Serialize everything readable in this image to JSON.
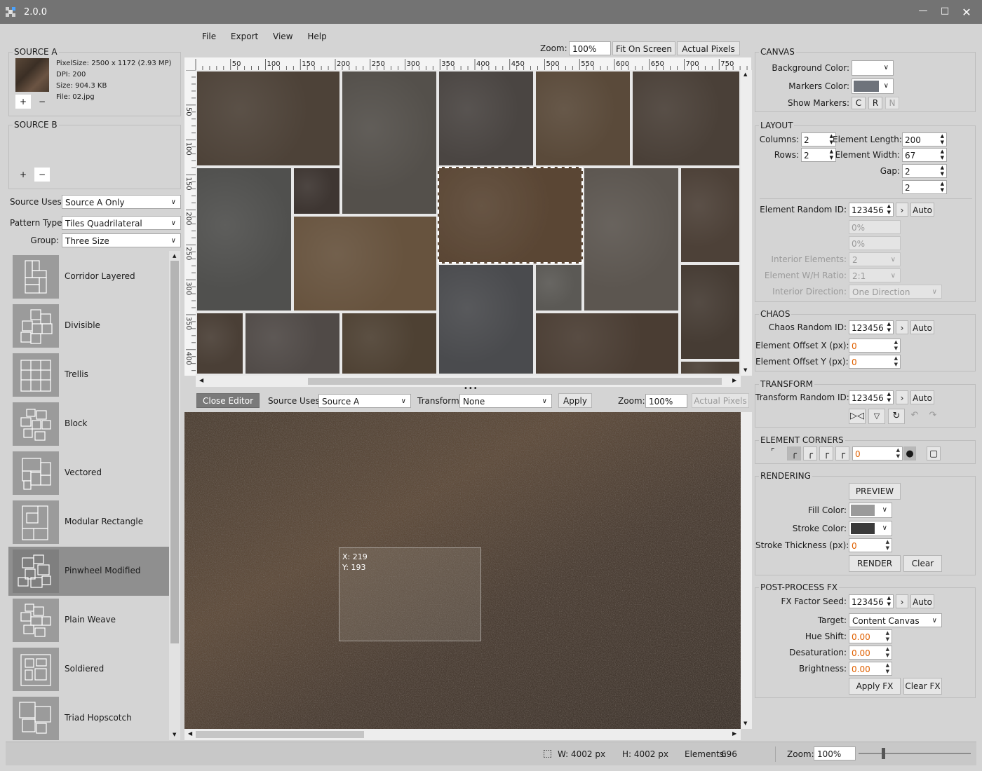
{
  "window": {
    "title": "2.0.0",
    "controls": [
      "minimize-icon",
      "maximize-icon",
      "close-icon"
    ]
  },
  "menu": [
    "File",
    "Export",
    "View",
    "Help"
  ],
  "zoom_bar": {
    "label": "Zoom:",
    "value": "100%",
    "fit": "Fit On Screen",
    "actual": "Actual Pixels"
  },
  "source_a": {
    "title": "SOURCE A",
    "info": [
      "PixelSize: 2500 x 1172 (2.93 MP)",
      "DPI: 200",
      "Size: 904.3 KB",
      "File: 02.jpg"
    ],
    "add": "+",
    "remove": "−"
  },
  "source_b": {
    "title": "SOURCE B",
    "add": "+",
    "remove": "−"
  },
  "left_form": {
    "source_uses_label": "Source Uses:",
    "source_uses": "Source A Only",
    "pattern_type_label": "Pattern Type:",
    "pattern_type": "Tiles Quadrilateral",
    "group_label": "Group:",
    "group": "Three Size"
  },
  "patterns": [
    "Corridor Layered",
    "Divisible",
    "Trellis",
    "Block",
    "Vectored",
    "Modular Rectangle",
    "Pinwheel Modified",
    "Plain Weave",
    "Soldiered",
    "Triad Hopscotch"
  ],
  "selected_pattern": "Pinwheel Modified",
  "ruler": {
    "h": [
      "50",
      "100",
      "150",
      "200",
      "250",
      "300",
      "350",
      "400",
      "450",
      "500",
      "550",
      "600",
      "650",
      "700",
      "750"
    ],
    "v": [
      "50",
      "100",
      "150",
      "200",
      "250",
      "300",
      "350",
      "400"
    ]
  },
  "editor": {
    "close": "Close Editor",
    "source_uses_label": "Source Uses:",
    "source_uses": "Source A",
    "transform_label": "Transform:",
    "transform": "None",
    "apply": "Apply",
    "zoom_label": "Zoom:",
    "zoom": "100%",
    "actual": "Actual Pixels",
    "sel_x": "X: 219",
    "sel_y": "Y: 193"
  },
  "canvas": {
    "title": "CANVAS",
    "bg_label": "Background Color:",
    "bg_color": "#ffffff",
    "markers_label": "Markers Color:",
    "markers_color": "#6e737b",
    "show_markers_label": "Show Markers:",
    "markers": [
      "C",
      "R",
      "N"
    ]
  },
  "layout": {
    "title": "LAYOUT",
    "columns_label": "Columns:",
    "columns": "2",
    "rows_label": "Rows:",
    "rows": "2",
    "el_length_label": "Element Length:",
    "el_length": "200",
    "el_width_label": "Element Width:",
    "el_width": "67",
    "gap_label": "Gap:",
    "gap1": "2",
    "gap2": "2",
    "rand_label": "Element Random ID:",
    "rand": "123456",
    "auto": "Auto",
    "pct1": "0%",
    "pct2": "0%",
    "interior_label": "Interior Elements:",
    "interior": "2",
    "ratio_label": "Element W/H Ratio:",
    "ratio": "2:1",
    "direction_label": "Interior Direction:",
    "direction": "One Direction"
  },
  "chaos": {
    "title": "CHAOS",
    "rand_label": "Chaos Random ID:",
    "rand": "123456",
    "auto": "Auto",
    "offx_label": "Element Offset X (px):",
    "offx": "0",
    "offy_label": "Element Offset Y (px):",
    "offy": "0"
  },
  "transform": {
    "title": "TRANSFORM",
    "rand_label": "Transform Random ID:",
    "rand": "123456",
    "auto": "Auto"
  },
  "corners": {
    "title": "ELEMENT CORNERS",
    "value": "0"
  },
  "rendering": {
    "title": "RENDERING",
    "preview": "PREVIEW",
    "fill_label": "Fill Color:",
    "fill_color": "#9a9a9a",
    "stroke_label": "Stroke Color:",
    "stroke_color": "#3a3a3a",
    "thick_label": "Stroke Thickness (px):",
    "thick": "0",
    "render": "RENDER",
    "clear": "Clear"
  },
  "postfx": {
    "title": "POST-PROCESS FX",
    "seed_label": "FX Factor Seed:",
    "seed": "123456",
    "auto": "Auto",
    "target_label": "Target:",
    "target": "Content Canvas",
    "hue_label": "Hue Shift:",
    "hue": "0.00",
    "desat_label": "Desaturation:",
    "desat": "0.00",
    "bright_label": "Brightness:",
    "bright": "0.00",
    "apply": "Apply FX",
    "clear": "Clear FX"
  },
  "status": {
    "w": "W: 4002 px",
    "h": "H: 4002 px",
    "elements_label": "Elements:",
    "elements": "696",
    "zoom_label": "Zoom:",
    "zoom": "100%"
  }
}
